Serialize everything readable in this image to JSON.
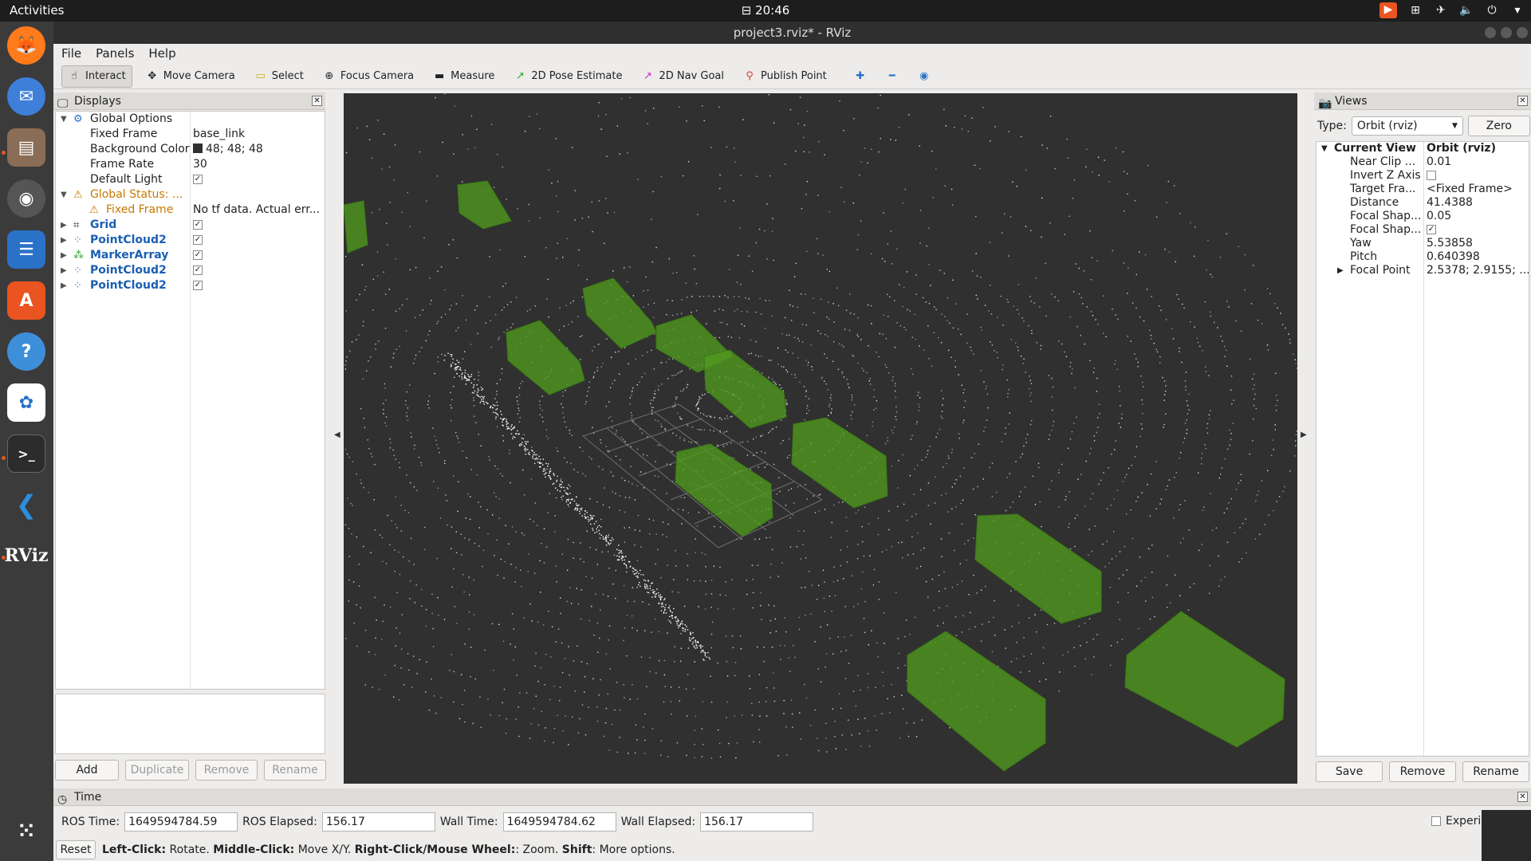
{
  "topbar": {
    "activities": "Activities",
    "time": "20:46"
  },
  "window": {
    "title": "project3.rviz* - RViz"
  },
  "menu": [
    "File",
    "Panels",
    "Help"
  ],
  "toolbar": {
    "tools": [
      {
        "label": "Interact",
        "icon": "hand-icon"
      },
      {
        "label": "Move Camera",
        "icon": "move-icon"
      },
      {
        "label": "Select",
        "icon": "select-icon"
      },
      {
        "label": "Focus Camera",
        "icon": "focus-icon"
      },
      {
        "label": "Measure",
        "icon": "ruler-icon"
      },
      {
        "label": "2D Pose Estimate",
        "icon": "green-arrow-icon"
      },
      {
        "label": "2D Nav Goal",
        "icon": "pink-arrow-icon"
      },
      {
        "label": "Publish Point",
        "icon": "pin-icon"
      }
    ]
  },
  "displays": {
    "title": "Displays",
    "rows": [
      {
        "label": "Global Options",
        "value": ""
      },
      {
        "label": "Fixed Frame",
        "value": "base_link"
      },
      {
        "label": "Background Color",
        "value": "48; 48; 48"
      },
      {
        "label": "Frame Rate",
        "value": "30"
      },
      {
        "label": "Default Light",
        "value": ""
      },
      {
        "label": "Global Status: ...",
        "value": ""
      },
      {
        "label": "Fixed Frame",
        "value": "No tf data.  Actual err..."
      },
      {
        "label": "Grid",
        "value": ""
      },
      {
        "label": "PointCloud2",
        "value": ""
      },
      {
        "label": "MarkerArray",
        "value": ""
      },
      {
        "label": "PointCloud2",
        "value": ""
      },
      {
        "label": "PointCloud2",
        "value": ""
      }
    ],
    "buttons": [
      "Add",
      "Duplicate",
      "Remove",
      "Rename"
    ]
  },
  "views": {
    "title": "Views",
    "type_label": "Type:",
    "type_value": "Orbit (rviz)",
    "zero": "Zero",
    "rows": [
      {
        "label": "Current View",
        "value": "Orbit (rviz)"
      },
      {
        "label": "Near Clip ...",
        "value": "0.01"
      },
      {
        "label": "Invert Z Axis",
        "value": ""
      },
      {
        "label": "Target Fra...",
        "value": "<Fixed Frame>"
      },
      {
        "label": "Distance",
        "value": "41.4388"
      },
      {
        "label": "Focal Shap...",
        "value": "0.05"
      },
      {
        "label": "Focal Shap...",
        "value": ""
      },
      {
        "label": "Yaw",
        "value": "5.53858"
      },
      {
        "label": "Pitch",
        "value": "0.640398"
      },
      {
        "label": "Focal Point",
        "value": "2.5378; 2.9155; ..."
      }
    ],
    "buttons": [
      "Save",
      "Remove",
      "Rename"
    ]
  },
  "time": {
    "title": "Time",
    "ros_time_label": "ROS Time:",
    "ros_time": "1649594784.59",
    "ros_elapsed_label": "ROS Elapsed:",
    "ros_elapsed": "156.17",
    "wall_time_label": "Wall Time:",
    "wall_time": "1649594784.62",
    "wall_elapsed_label": "Wall Elapsed:",
    "wall_elapsed": "156.17",
    "experimental": "Experim",
    "reset": "Reset",
    "help": {
      "left": "Left-Click:",
      "left_t": "Rotate.",
      "middle": "Middle-Click:",
      "middle_t": "Move X/Y.",
      "right": "Right-Click/Mouse Wheel:",
      "right_t": ": Zoom.",
      "shift": "Shift",
      "shift_t": ": More options."
    }
  },
  "dock": {
    "apps": [
      "firefox-icon",
      "thunderbird-icon",
      "files-icon",
      "rhythmbox-icon",
      "writer-icon",
      "software-icon",
      "help-icon",
      "app-icon",
      "terminal-icon",
      "vscode-icon",
      "rviz-icon"
    ]
  }
}
